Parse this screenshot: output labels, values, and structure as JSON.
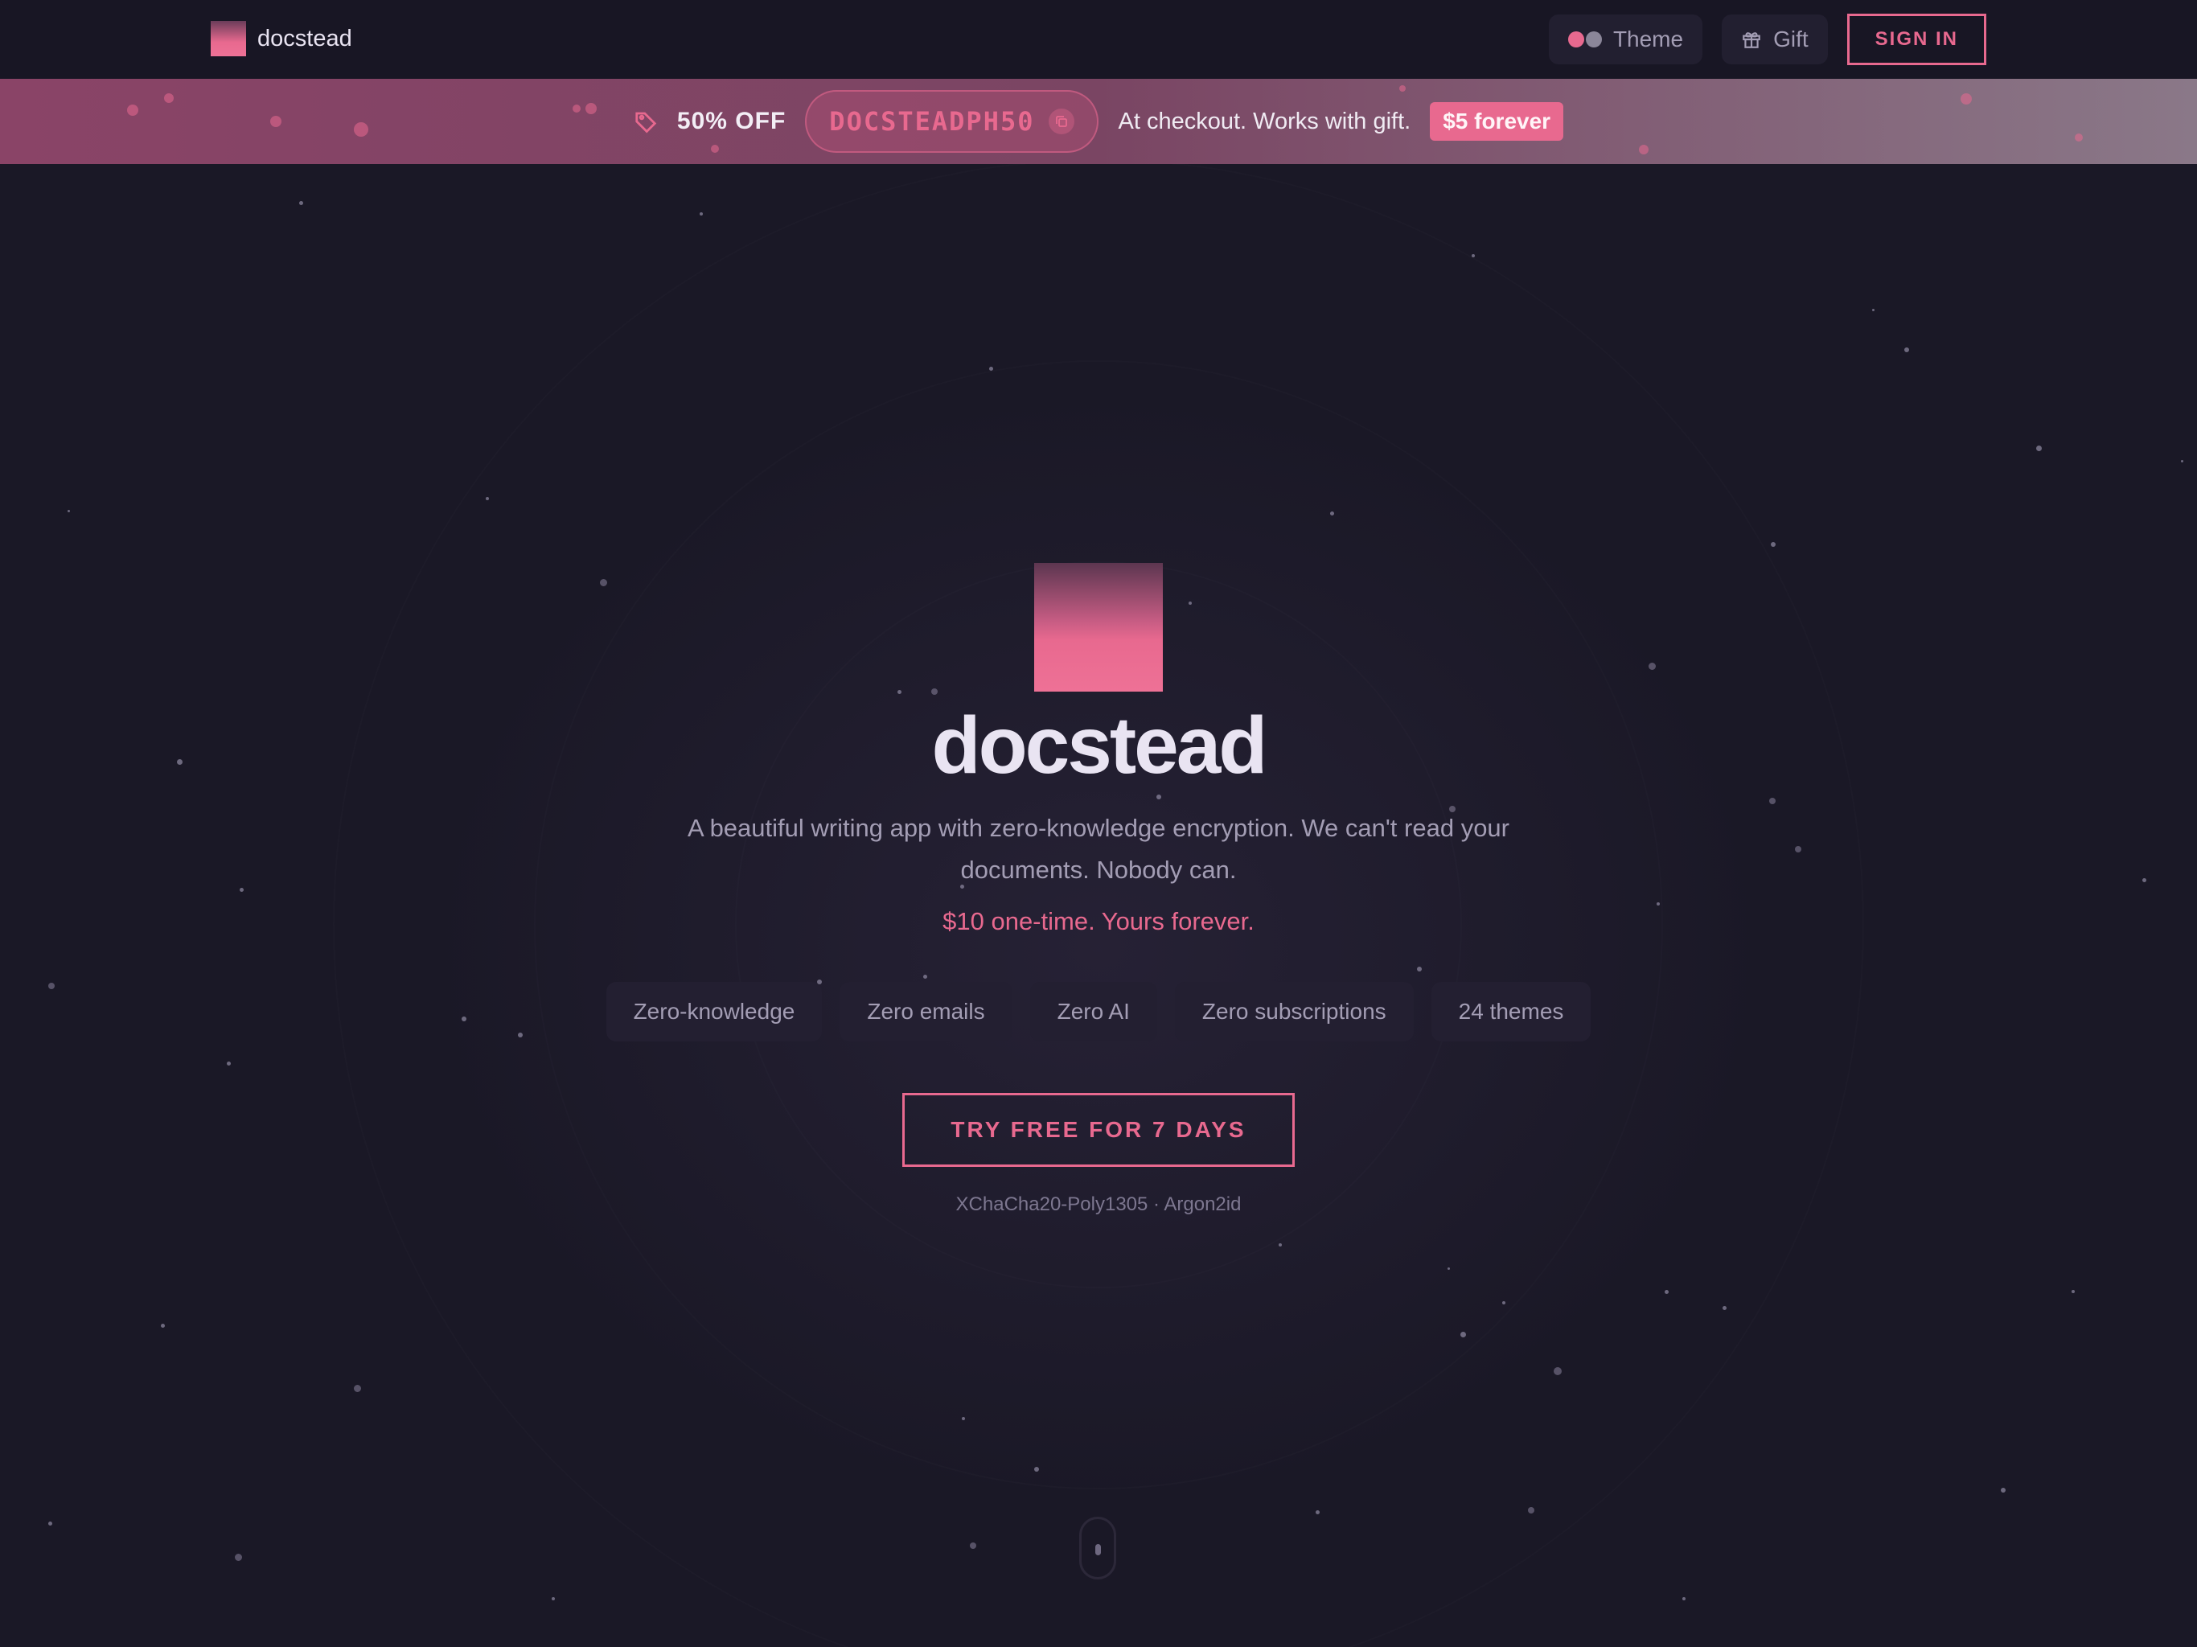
{
  "header": {
    "brand_name": "docstead",
    "theme_label": "Theme",
    "gift_label": "Gift",
    "signin_label": "SIGN IN"
  },
  "banner": {
    "discount": "50% OFF",
    "promo_code": "DOCSTEADPH50",
    "checkout_note": "At checkout. Works with gift.",
    "badge": "$5 forever"
  },
  "hero": {
    "title": "docstead",
    "subtitle": "A beautiful writing app with zero-knowledge encryption. We can't read your documents. Nobody can.",
    "price": "$10 one-time. Yours forever.",
    "features": [
      "Zero-knowledge",
      "Zero emails",
      "Zero AI",
      "Zero subscriptions",
      "24 themes"
    ],
    "cta_label": "TRY FREE FOR 7 DAYS",
    "crypto_note": "XChaCha20-Poly1305 · Argon2id"
  },
  "colors": {
    "accent": "#e8698f",
    "background": "#1a1826",
    "text": "#e9e4f2",
    "muted": "#a39db4"
  },
  "icons": {
    "theme": "theme-dots-icon",
    "gift": "gift-icon",
    "tag": "tag-icon",
    "copy": "copy-icon",
    "scroll": "scroll-mouse-icon"
  }
}
